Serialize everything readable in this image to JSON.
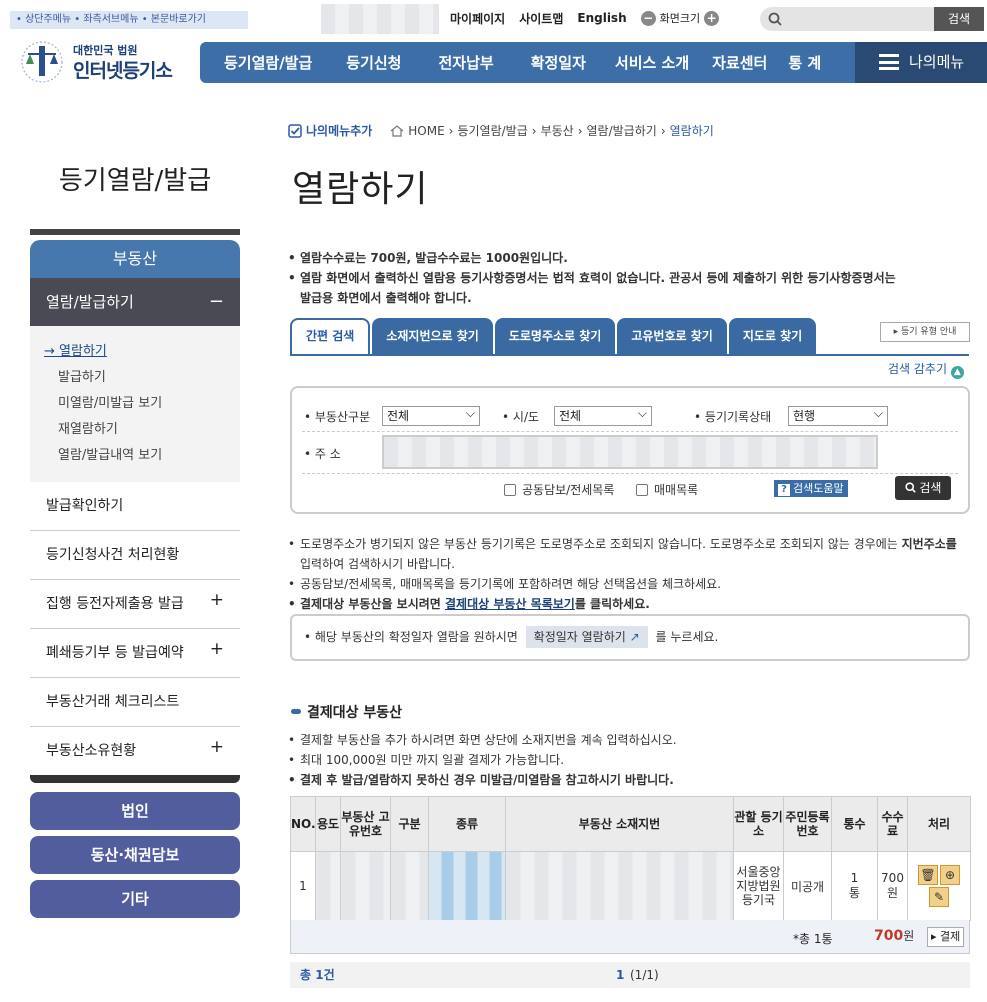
{
  "skip_links": "• 상단주메뉴 • 좌측서브메뉴 • 본문바로가기",
  "top_links": {
    "mypage": "마이페이지",
    "sitemap": "사이트맵",
    "english": "English",
    "zoom": "화면크기",
    "minus": "−",
    "plus": "+"
  },
  "search": {
    "button": "검색"
  },
  "logo": {
    "line1": "대한민국 법원",
    "line2": "인터넷등기소"
  },
  "gnb": {
    "items": [
      "등기열람/발급",
      "등기신청",
      "전자납부",
      "확정일자",
      "서비스 소개",
      "자료센터",
      "통 계"
    ],
    "my_menu": "나의메뉴"
  },
  "breadcrumb": {
    "add": "나의메뉴추가",
    "home": "HOME",
    "p1": "등기열람/발급",
    "p2": "부동산",
    "p3": "열람/발급하기",
    "p4": "열람하기"
  },
  "page_title": "열람하기",
  "lnb": {
    "title": "등기열람/발급",
    "head": "부동산",
    "selected": "열람/발급하기",
    "minus": "−",
    "sub": [
      "열람하기",
      "발급하기",
      "미열람/미발급 보기",
      "재열람하기",
      "열람/발급내역 보기"
    ],
    "items": [
      {
        "label": "발급확인하기",
        "plus": ""
      },
      {
        "label": "등기신청사건 처리현황",
        "plus": ""
      },
      {
        "label": "집행 등전자제출용 발급",
        "plus": "+"
      },
      {
        "label": "폐쇄등기부 등 발급예약",
        "plus": "+"
      },
      {
        "label": "부동산거래 체크리스트",
        "plus": ""
      },
      {
        "label": "부동산소유현황",
        "plus": "+"
      }
    ],
    "pills": [
      "법인",
      "동산·채권담보",
      "기타"
    ]
  },
  "notes": {
    "n1": "열람수수료는 700원, 발급수수료는 1000원입니다.",
    "n2a": "열람 화면에서 출력하신 열람용 등기사항증명서는 법적 효력이 없습니다. 관공서 등에 제출하기 위한 등기사항증명서는",
    "n2b": "발급용 화면에서 출력해야 합니다."
  },
  "tabs": [
    "간편 검색",
    "소재지번으로 찾기",
    "도로명주소로 찾기",
    "고유번호로 찾기",
    "지도로 찾기"
  ],
  "reg_type_help": "▸ 등기 유형 안내",
  "fold": "검색 감추기",
  "form": {
    "type_label": "부동산구분",
    "type_value": "전체",
    "sido_label": "시/도",
    "sido_value": "전체",
    "status_label": "등기기록상태",
    "status_value": "현행",
    "addr_label": "주 소",
    "chk1": "공동담보/전세목록",
    "chk2": "매매목록",
    "help": "검색도움말",
    "search": "검색"
  },
  "notes2": {
    "a": "도로명주소가 병기되지 않은 부동산 등기기록은 도로명주소로 조회되지 않습니다. 도로명주소로 조회되지 않는 경우에는 ",
    "a_bold": "지번주소를",
    "a2": "입력하여 검색하시기 바랍니다.",
    "b": "공동담보/전세목록, 매매목록을 등기기록에 포함하려면 해당 선택옵션을 체크하세요.",
    "c1": "결제대상 부동산을 보시려면 ",
    "c_link": "결제대상 부동산 목록보기",
    "c2": "를 클릭하세요."
  },
  "confirm": {
    "pre": "• 해당 부동산의 확정일자 열람을 원하시면",
    "btn": "확정일자 열람하기",
    "post": "를 누르세요."
  },
  "section_title": "결제대상 부동산",
  "notes3": {
    "a": "결제할 부동산을 추가 하시려면 화면 상단에 소재지번을 계속 입력하십시오.",
    "b": "최대 100,000원 미만 까지 일괄 결제가 가능합니다.",
    "c": "결제 후 발급/열람하지 못하신 경우 미발급/미열람을 참고하시기 바랍니다."
  },
  "table": {
    "headers": [
      "NO.",
      "용도",
      "부동산 고유번호",
      "구분",
      "종류",
      "부동산 소재지번",
      "관할 등기소",
      "주민등록번호",
      "통수",
      "수수료",
      "처리"
    ],
    "row": {
      "no": "1",
      "office": "서울중앙지방법원 등기국",
      "rrn": "미공개",
      "count": "1",
      "count_unit": "통",
      "fee": "700",
      "fee_unit": "원"
    },
    "total_label": "*총 1통",
    "total_amount": "700",
    "total_unit": "원",
    "pay": "▸ 결제"
  },
  "pager": {
    "total": "총 1건",
    "page": "1",
    "range": "(1/1)"
  }
}
